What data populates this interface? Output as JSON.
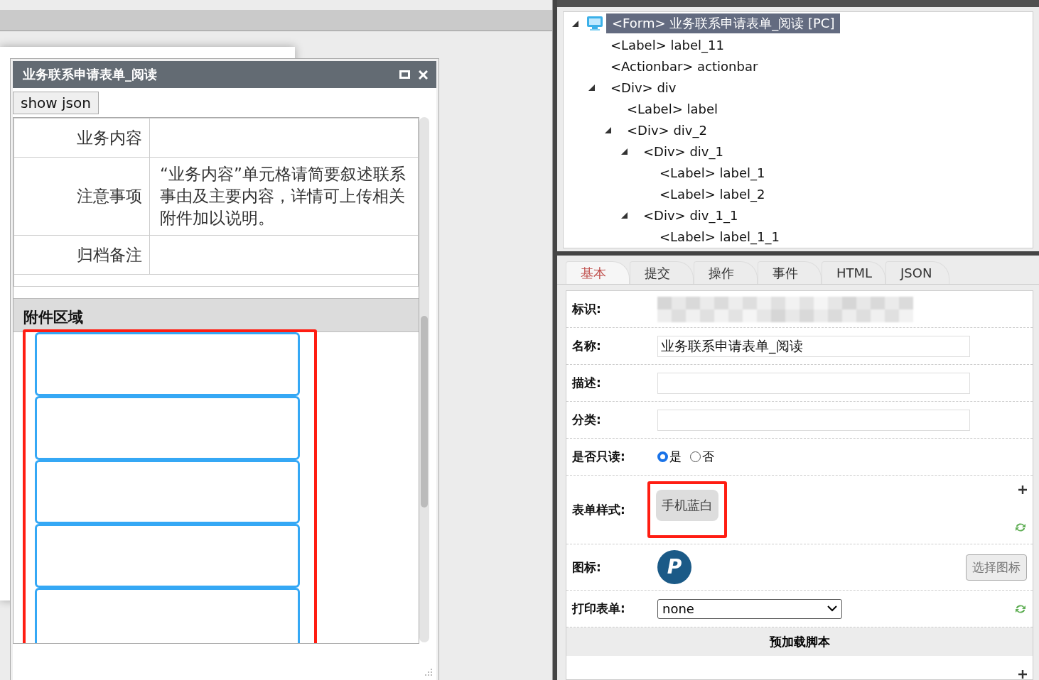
{
  "dialog": {
    "title": "业务联系申请表单_阅读",
    "button": "show json",
    "rows": [
      {
        "label": "业务内容"
      },
      {
        "label": "注意事项",
        "value": "“业务内容”单元格请简要叙述联系事由及主要内容，详情可上传相关附件加以说明。"
      },
      {
        "label": "归档备注"
      }
    ],
    "section_title": "附件区域"
  },
  "tree": [
    {
      "label": "<Form> 业务联系申请表单_阅读 [PC]",
      "expanded": true,
      "selected": true,
      "children": [
        {
          "label": "<Label> label_11",
          "selected": false
        },
        {
          "label": "<Actionbar> actionbar",
          "selected": false
        },
        {
          "label": "<Div> div",
          "expanded": true,
          "selected": false,
          "children": [
            {
              "label": "<Label> label",
              "selected": false
            },
            {
              "label": "<Div> div_2",
              "expanded": true,
              "selected": false,
              "children": [
                {
                  "label": "<Div> div_1",
                  "expanded": true,
                  "selected": false,
                  "children": [
                    {
                      "label": "<Label> label_1",
                      "selected": false
                    },
                    {
                      "label": "<Label> label_2",
                      "selected": false
                    }
                  ]
                },
                {
                  "label": "<Div> div_1_1",
                  "expanded": true,
                  "selected": false,
                  "children": [
                    {
                      "label": "<Label> label_1_1",
                      "selected": false
                    }
                  ]
                }
              ]
            }
          ]
        }
      ]
    }
  ],
  "tabs": [
    {
      "label": "基本",
      "selected": true
    },
    {
      "label": "提交",
      "selected": false
    },
    {
      "label": "操作",
      "selected": false
    },
    {
      "label": "事件",
      "selected": false
    },
    {
      "label": "HTML",
      "selected": false
    },
    {
      "label": "JSON",
      "selected": false
    }
  ],
  "properties": [
    {
      "kind": "redacted",
      "label": "标识:"
    },
    {
      "kind": "text",
      "label": "名称:",
      "value": "业务联系申请表单_阅读"
    },
    {
      "kind": "text",
      "label": "描述:"
    },
    {
      "kind": "text",
      "label": "分类:"
    },
    {
      "kind": "radio",
      "label": "是否只读:",
      "options": [
        {
          "label": "是",
          "selected": true
        },
        {
          "label": "否",
          "selected": false
        }
      ]
    },
    {
      "kind": "style",
      "label": "表单样式:",
      "value": "手机蓝白"
    },
    {
      "kind": "icon",
      "label": "图标:",
      "icon_text": "P",
      "button": "选择图标"
    },
    {
      "kind": "select",
      "label": "打印表单:",
      "value": "none"
    },
    {
      "kind": "section",
      "label": "预加载脚本"
    },
    {
      "kind": "add"
    }
  ]
}
